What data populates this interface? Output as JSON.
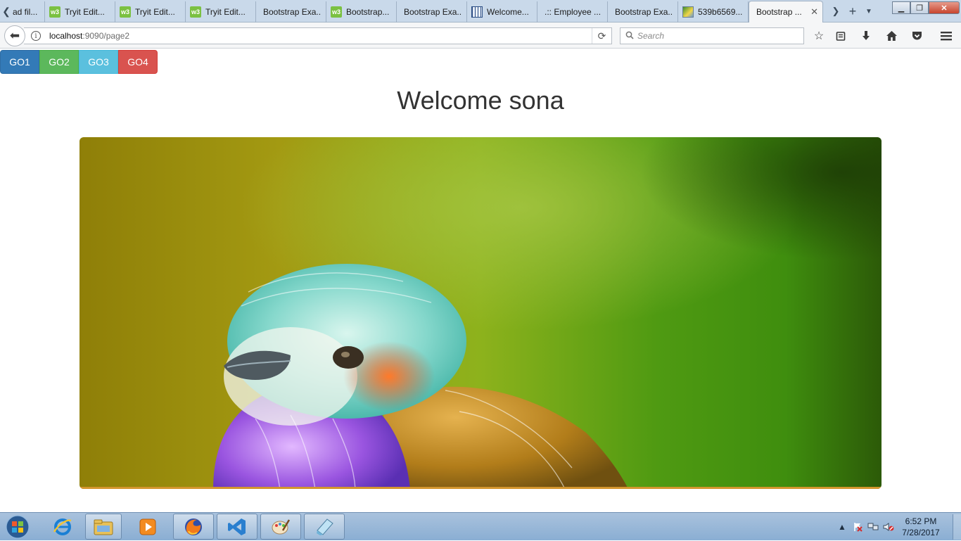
{
  "browser": {
    "tabs": [
      {
        "label": "ad fil...",
        "icon": "none"
      },
      {
        "label": "Tryit Edit...",
        "icon": "w3-icon"
      },
      {
        "label": "Tryit Edit...",
        "icon": "w3-icon"
      },
      {
        "label": "Tryit Edit...",
        "icon": "w3-icon"
      },
      {
        "label": "Bootstrap Exa...",
        "icon": "none"
      },
      {
        "label": "Bootstrap...",
        "icon": "w3-icon"
      },
      {
        "label": "Bootstrap Exa...",
        "icon": "none"
      },
      {
        "label": "Welcome...",
        "icon": "grid-icon"
      },
      {
        "label": ".:: Employee ...",
        "icon": "none"
      },
      {
        "label": "Bootstrap Exa...",
        "icon": "none"
      },
      {
        "label": "539b6569...",
        "icon": "image-icon"
      }
    ],
    "active_tab": {
      "label": "Bootstrap ..."
    },
    "url": {
      "host": "localhost",
      "path": ":9090/page2"
    },
    "search": {
      "placeholder": "Search"
    }
  },
  "page": {
    "buttons": [
      {
        "label": "GO1",
        "color": "#337ab7"
      },
      {
        "label": "GO2",
        "color": "#5cb85c"
      },
      {
        "label": "GO3",
        "color": "#5bc0de"
      },
      {
        "label": "GO4",
        "color": "#d9534f"
      }
    ],
    "title": "Welcome sona"
  },
  "taskbar": {
    "apps": [
      "internet-explorer-icon",
      "file-explorer-icon",
      "media-player-icon",
      "firefox-icon",
      "visual-studio-icon",
      "paint-icon",
      "notepad-icon"
    ],
    "clock": {
      "time": "6:52 PM",
      "date": "7/28/2017"
    }
  }
}
